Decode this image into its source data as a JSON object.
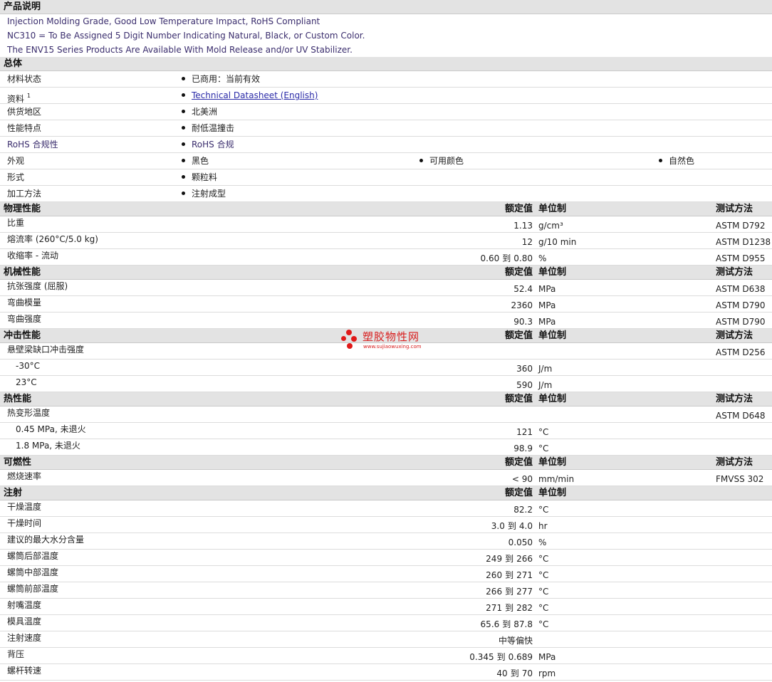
{
  "header_cols": {
    "value": "额定值",
    "unit": "单位制",
    "test": "测试方法"
  },
  "description": {
    "title": "产品说明",
    "lines": [
      "Injection Molding Grade, Good Low Temperature Impact, RoHS Compliant",
      "NC310 = To Be Assigned 5 Digit Number Indicating Natural, Black, or Custom Color.",
      "The ENV15 Series Products Are Available With Mold Release and/or UV Stabilizer."
    ]
  },
  "general": {
    "title": "总体",
    "rows": [
      {
        "label": "材料状态",
        "values": [
          "已商用：当前有效"
        ]
      },
      {
        "label": "资料",
        "sup": "1",
        "values": [
          "Technical Datasheet (English)"
        ]
      },
      {
        "label": "供货地区",
        "values": [
          "北美洲"
        ]
      },
      {
        "label": "性能特点",
        "values": [
          "耐低温撞击"
        ]
      },
      {
        "label": "RoHS 合规性",
        "values": [
          "RoHS 合规"
        ]
      },
      {
        "label": "外观",
        "values": [
          "黑色",
          "可用颜色",
          "自然色"
        ]
      },
      {
        "label": "形式",
        "values": [
          "颗粒料"
        ]
      },
      {
        "label": "加工方法",
        "values": [
          "注射成型"
        ]
      }
    ]
  },
  "physical": {
    "title": "物理性能",
    "rows": [
      {
        "label": "比重",
        "value": "1.13",
        "unit": "g/cm³",
        "test": "ASTM D792"
      },
      {
        "label": "熔流率 (260°C/5.0 kg)",
        "value": "12",
        "unit": "g/10 min",
        "test": "ASTM D1238"
      },
      {
        "label": "收缩率  - 流动",
        "min": "0.60",
        "max": "0.80",
        "unit": "%",
        "test": "ASTM D955"
      }
    ]
  },
  "mechanical": {
    "title": "机械性能",
    "rows": [
      {
        "label": "抗张强度 (屈服)",
        "value": "52.4",
        "unit": "MPa",
        "test": "ASTM D638"
      },
      {
        "label": "弯曲模量",
        "value": "2360",
        "unit": "MPa",
        "test": "ASTM D790"
      },
      {
        "label": "弯曲强度",
        "value": "90.3",
        "unit": "MPa",
        "test": "ASTM D790"
      }
    ]
  },
  "impact": {
    "title": "冲击性能",
    "rows": [
      {
        "label": "悬壁梁缺口冲击强度",
        "value": "",
        "unit": "",
        "test": "ASTM D256"
      },
      {
        "label": "-30°C",
        "sub": true,
        "value": "360",
        "unit": "J/m",
        "test": ""
      },
      {
        "label": "23°C",
        "sub": true,
        "value": "590",
        "unit": "J/m",
        "test": ""
      }
    ]
  },
  "thermal": {
    "title": "热性能",
    "rows": [
      {
        "label": "热变形温度",
        "value": "",
        "unit": "",
        "test": "ASTM D648"
      },
      {
        "label": "0.45 MPa, 未退火",
        "sub": true,
        "value": "121",
        "unit": "°C",
        "test": ""
      },
      {
        "label": "1.8 MPa, 未退火",
        "sub": true,
        "value": "98.9",
        "unit": "°C",
        "test": ""
      }
    ]
  },
  "flammability": {
    "title": "可燃性",
    "rows": [
      {
        "label": "燃烧速率",
        "value": "< 90",
        "unit": "mm/min",
        "test": "FMVSS 302"
      }
    ]
  },
  "injection": {
    "title": "注射",
    "rows": [
      {
        "label": "干燥温度",
        "value": "82.2",
        "unit": "°C"
      },
      {
        "label": "干燥时间",
        "min": "3.0",
        "max": "4.0",
        "unit": "hr"
      },
      {
        "label": "建议的最大水分含量",
        "value": "0.050",
        "unit": "%"
      },
      {
        "label": "螺筒后部温度",
        "min": "249",
        "max": "266",
        "unit": "°C"
      },
      {
        "label": "螺筒中部温度",
        "min": "260",
        "max": "271",
        "unit": "°C"
      },
      {
        "label": "螺筒前部温度",
        "min": "266",
        "max": "277",
        "unit": "°C"
      },
      {
        "label": "射嘴温度",
        "min": "271",
        "max": "282",
        "unit": "°C"
      },
      {
        "label": "模具温度",
        "min": "65.6",
        "max": "87.8",
        "unit": "°C"
      },
      {
        "label": "注射速度",
        "value": "中等偏快",
        "unit": ""
      },
      {
        "label": "背压",
        "min": "0.345",
        "max": "0.689",
        "unit": "MPa"
      },
      {
        "label": "螺杆转速",
        "min": "40",
        "max": "70",
        "unit": "rpm"
      }
    ]
  },
  "range_word": "到",
  "watermark": {
    "text": "塑胶物性网",
    "url": "www.sujiaowuxing.com"
  }
}
